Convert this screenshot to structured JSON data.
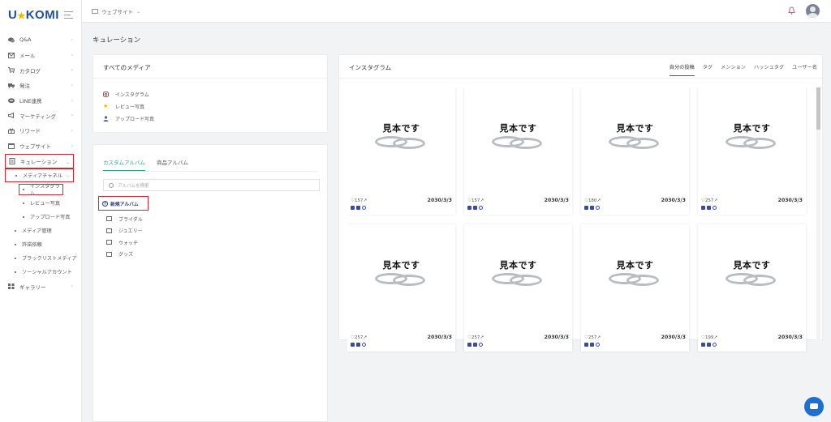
{
  "logo": {
    "brand_left": "U",
    "brand_right": "KOMI"
  },
  "sidebar": {
    "items": [
      {
        "label": "Q&A",
        "icon": "chat-bubbles-icon"
      },
      {
        "label": "メール",
        "icon": "mail-icon"
      },
      {
        "label": "カタログ",
        "icon": "cart-icon"
      },
      {
        "label": "発注",
        "icon": "truck-icon"
      },
      {
        "label": "LINE連携",
        "icon": "line-icon"
      },
      {
        "label": "マーケティング",
        "icon": "megaphone-icon"
      },
      {
        "label": "リワード",
        "icon": "gift-icon"
      },
      {
        "label": "ウェブサイト",
        "icon": "window-icon"
      },
      {
        "label": "キュレーション",
        "icon": "document-icon"
      }
    ],
    "curation_sub": {
      "media_channel": "メディアチャネル",
      "instagram": "インスタグラム",
      "review_photos": "レビュー写真",
      "upload_photos": "アップロード写真",
      "media_management": "メディア管理",
      "rights_request": "許諾依頼",
      "blacklist_media": "ブラックリストメディア",
      "social_accounts": "ソーシャルアカウント"
    },
    "gallery": {
      "label": "ギャラリー",
      "icon": "grid-icon"
    }
  },
  "topbar": {
    "site_selector": "ウェブサイト"
  },
  "page_title": "キュレーション",
  "all_media": {
    "title": "すべてのメディア",
    "items": [
      {
        "label": "インスタグラム",
        "icon": "instagram-icon",
        "color": "#e1306c"
      },
      {
        "label": "レビュー写真",
        "icon": "star-icon",
        "color": "#f3b400"
      },
      {
        "label": "アップロード写真",
        "icon": "user-icon",
        "color": "#4a5aa8"
      }
    ]
  },
  "albums": {
    "tabs": [
      "カスタムアルバム",
      "商品アルバム"
    ],
    "search_placeholder": "アルバムを検索",
    "new_album": "新規アルバム",
    "list": [
      "ブライダル",
      "ジュエリー",
      "ウォッチ",
      "グッズ"
    ]
  },
  "instagram": {
    "title": "インスタグラム",
    "tabs": [
      "自分の投稿",
      "タグ",
      "メンション",
      "ハッシュタグ",
      "ユーザー名"
    ],
    "posts": [
      {
        "caption": "見本です",
        "likes": "157",
        "date": "2030/3/3"
      },
      {
        "caption": "見本です",
        "likes": "157",
        "date": "2030/3/3"
      },
      {
        "caption": "見本です",
        "likes": "180",
        "date": "2030/3/3"
      },
      {
        "caption": "見本です",
        "likes": "257",
        "date": "2030/3/3"
      },
      {
        "caption": "見本です",
        "likes": "257",
        "date": "2030/3/3"
      },
      {
        "caption": "見本です",
        "likes": "257",
        "date": "2030/3/3"
      },
      {
        "caption": "見本です",
        "likes": "257",
        "date": "2030/3/3"
      },
      {
        "caption": "見本です",
        "likes": "199",
        "date": "2030/3/3"
      }
    ]
  },
  "colors": {
    "brand": "#1e4fa8",
    "accent_green": "#2fa28c",
    "highlight_red": "#d9232e",
    "chat_blue": "#1f6fd0"
  }
}
